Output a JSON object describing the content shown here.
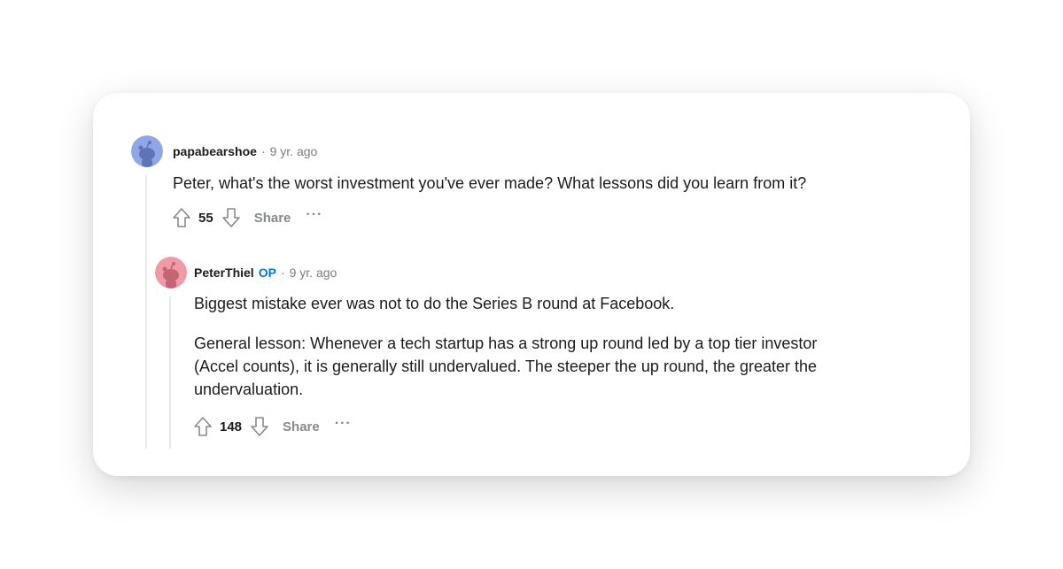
{
  "comments": [
    {
      "author": "papabearshoe",
      "separator": "·",
      "time": "9 yr. ago",
      "paragraphs": [
        "Peter, what's the worst investment you've ever made? What lessons did you learn from it?"
      ],
      "score": "55",
      "share_label": "Share",
      "more_label": "···",
      "avatar_color": "#8fa7e8",
      "icons": [
        "upvote-arrow-icon",
        "downvote-arrow-icon",
        "more-options-icon"
      ]
    },
    {
      "author": "PeterThiel",
      "op_badge": "OP",
      "separator": "·",
      "time": "9 yr. ago",
      "paragraphs": [
        "Biggest mistake ever was not to do the Series B round at Facebook.",
        "General lesson: Whenever a tech startup has a strong up round led by a top tier investor (Accel counts), it is generally still undervalued. The steeper the up round, the greater the undervaluation."
      ],
      "score": "148",
      "share_label": "Share",
      "more_label": "···",
      "avatar_color": "#f19aa6",
      "icons": [
        "upvote-arrow-icon",
        "downvote-arrow-icon",
        "more-options-icon"
      ]
    }
  ],
  "colors": {
    "op_badge": "#0079d3",
    "muted_text": "#7c7c7c",
    "thread_line": "#e6e8ea"
  }
}
